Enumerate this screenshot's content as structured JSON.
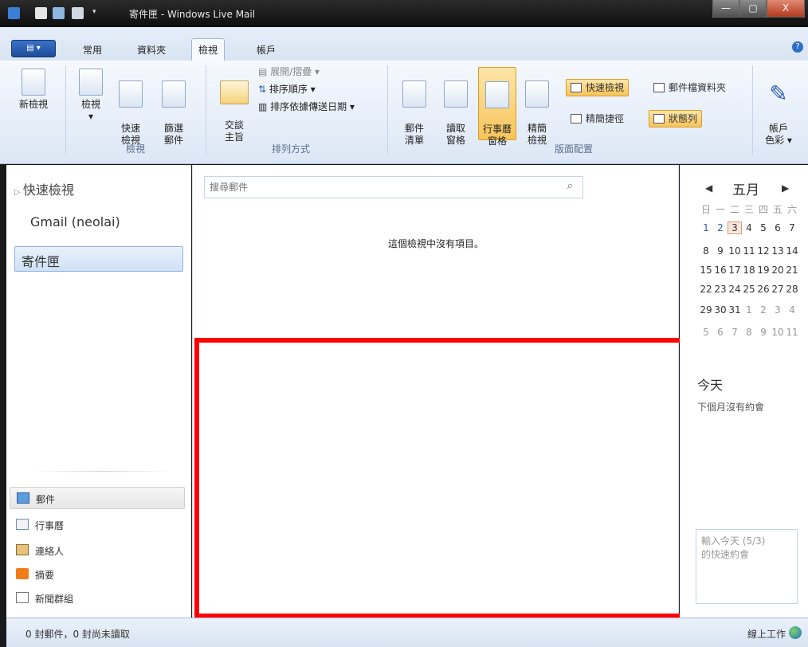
{
  "window": {
    "title_prefix": "寄件匣",
    "title_app": "Windows Live Mail",
    "controls": [
      "—",
      "▢",
      "X"
    ]
  },
  "tabs": [
    "常用",
    "資料夾",
    "檢視",
    "帳戶"
  ],
  "active_tab": "檢視",
  "ribbon": {
    "new_view": "新檢視",
    "view": "檢視",
    "quick_view": "快速\n檢視",
    "filter": "篩選\n郵件",
    "group_view": "檢視",
    "conversations": "交談\n主旨",
    "expand_collapse": "展開/摺疊",
    "sort_order": "排序順序",
    "sort_by": "排序依據傳送日期",
    "group_sort": "排列方式",
    "message_list": "郵件\n清單",
    "reading_pane": "讀取\n窗格",
    "calendar_pane": "行事曆\n窗格",
    "compact_view": "精簡\n檢視",
    "quick_views_toggle": "快速檢視",
    "storage_folder": "郵件檔資料夾",
    "compact_shortcuts": "精簡捷徑",
    "status_bar": "狀態列",
    "group_layout": "版面配置",
    "account_color": "帳戶\n色彩"
  },
  "sidebar": {
    "quick_views": "快速檢視",
    "account": "Gmail (neolai)",
    "selected_folder": "寄件匣",
    "nav": [
      "郵件",
      "行事曆",
      "連絡人",
      "摘要",
      "新聞群組"
    ]
  },
  "main": {
    "search_placeholder": "搜尋郵件",
    "empty_message": "這個檢視中沒有項目。"
  },
  "calendar": {
    "month": "五月",
    "weekdays": [
      "日",
      "一",
      "二",
      "三",
      "四",
      "五",
      "六"
    ],
    "weeks": [
      [
        "1",
        "2",
        "3",
        "4",
        "5",
        "6",
        "7"
      ],
      [
        "8",
        "9",
        "10",
        "11",
        "12",
        "13",
        "14"
      ],
      [
        "15",
        "16",
        "17",
        "18",
        "19",
        "20",
        "21"
      ],
      [
        "22",
        "23",
        "24",
        "25",
        "26",
        "27",
        "28"
      ],
      [
        "29",
        "30",
        "31",
        "1",
        "2",
        "3",
        "4"
      ],
      [
        "5",
        "6",
        "7",
        "8",
        "9",
        "10",
        "11"
      ]
    ],
    "today_label": "今天",
    "no_appointments": "下個月沒有約會",
    "quick_entry": "輸入今天 (5/3)\n的快速約會"
  },
  "status": {
    "counts": "0 封郵件，0 封尚未讀取",
    "online": "線上工作"
  },
  "colors": {
    "highlight_box": "#ff0000",
    "accent": "#2b5fb0"
  }
}
